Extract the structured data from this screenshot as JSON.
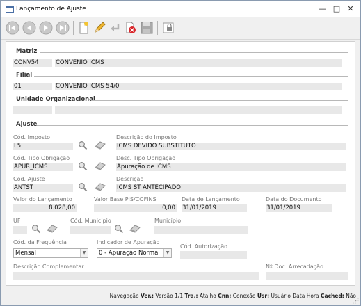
{
  "window": {
    "title": "Lançamento de Ajuste"
  },
  "toolbar": {
    "buttons": [
      "first-record",
      "previous-record",
      "next-record",
      "last-record",
      "new",
      "edit",
      "undo",
      "delete",
      "save",
      "lock"
    ]
  },
  "matriz": {
    "label": "Matriz",
    "code": "CONV54",
    "name": "CONVÊNIO ICMS"
  },
  "filial": {
    "label": "Filial",
    "code": "01",
    "name": "CONVÊNIO ICMS 54/0"
  },
  "unidade": {
    "label": "Unidade Organizacional",
    "code": "",
    "name": ""
  },
  "ajuste": {
    "label": "Ajuste",
    "cod_imposto": {
      "label": "Cód. Imposto",
      "value": "L5"
    },
    "desc_imposto": {
      "label": "Descrição do Imposto",
      "value": "ICMS DEVIDO SUBSTITUTO"
    },
    "cod_tipo_obrig": {
      "label": "Cód. Tipo Obrigação",
      "value": "APUR_ICMS"
    },
    "desc_tipo_obrig": {
      "label": "Desc. Tipo Obrigação",
      "value": "Apuração de ICMS"
    },
    "cod_ajuste": {
      "label": "Cod. Ajuste",
      "value": "ANTST"
    },
    "descricao": {
      "label": "Descrição",
      "value": "ICMS ST ANTECIPADO"
    },
    "valor_lancamento": {
      "label": "Valor do Lançamento",
      "value": "8.028,00"
    },
    "valor_base": {
      "label": "Valor Base PIS/COFINS",
      "value": "0,00"
    },
    "data_lancamento": {
      "label": "Data de Lançamento",
      "value": "31/01/2019"
    },
    "data_documento": {
      "label": "Data do Documento",
      "value": "31/01/2019"
    },
    "uf": {
      "label": "UF",
      "value": ""
    },
    "cod_municipio": {
      "label": "Cód. Município",
      "value": ""
    },
    "municipio": {
      "label": "Município",
      "value": ""
    },
    "cod_frequencia": {
      "label": "Cód. da Frequência",
      "value": "Mensal"
    },
    "indicador_apuracao": {
      "label": "Indicador de Apuração",
      "value": "0 - Apuração Normal"
    },
    "cod_autorizacao": {
      "label": "Cód. Autorização",
      "value": ""
    },
    "descricao_complementar": {
      "label": "Descrição Complementar",
      "value": ""
    },
    "num_doc_arrecadacao": {
      "label": "Nº Doc. Arrecadação",
      "value": ""
    }
  },
  "status": {
    "nav_label": "Navegação",
    "ver_key": "Ver.:",
    "ver_val": "Versão 1/1",
    "tra_key": "Tra.:",
    "tra_val": "Atalho",
    "cnn_key": "Cnn:",
    "cnn_val": "Conexão",
    "usr_key": "Usr:",
    "usr_val": "Usuário Data Hora",
    "cached_key": "Cached:",
    "cached_val": "Não"
  },
  "colors": {
    "field_bg": "#e8e8e8",
    "group_line": "#b8b8b8",
    "delete_red": "#d9262b"
  }
}
